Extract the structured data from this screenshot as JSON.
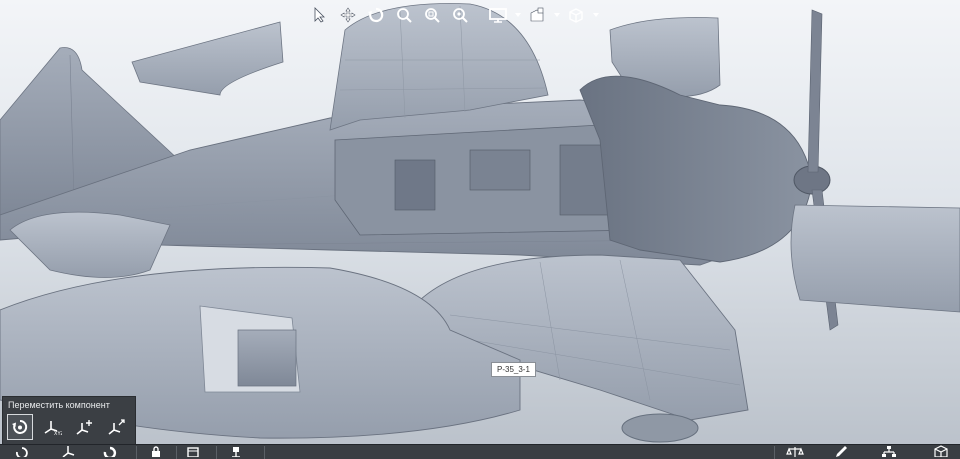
{
  "app": {
    "accent_color": "#2a6fd6",
    "toolbar_icon_color": "#ffffff"
  },
  "top_toolbar": {
    "buttons": [
      {
        "name": "select",
        "icon": "cursor-arrow-icon"
      },
      {
        "name": "pan",
        "icon": "move-arrows-icon"
      },
      {
        "name": "rotate",
        "icon": "orbit-rotate-icon"
      },
      {
        "name": "zoom",
        "icon": "zoom-icon"
      },
      {
        "name": "zoom-window",
        "icon": "zoom-window-icon"
      },
      {
        "name": "zoom-selected",
        "icon": "zoom-selected-icon"
      },
      {
        "name": "display-mode",
        "icon": "monitor-icon"
      },
      {
        "name": "appearance",
        "icon": "appearance-icon"
      },
      {
        "name": "view-orientation",
        "icon": "cube-view-icon"
      }
    ]
  },
  "viewport": {
    "part_tooltip": "P-35_3-1"
  },
  "move_panel": {
    "title": "Переместить компонент",
    "buttons": [
      {
        "name": "free-rotate",
        "icon": "rotate-component-icon",
        "active": true
      },
      {
        "name": "move-xyz",
        "icon": "triad-xyz-icon",
        "active": false
      },
      {
        "name": "move-along-entity",
        "icon": "triad-plus-icon",
        "active": false
      },
      {
        "name": "move-by-delta",
        "icon": "triad-arrows-icon",
        "active": false
      }
    ]
  },
  "bottom_toolbar": {
    "items": [
      {
        "icon": "rotate-component-icon"
      },
      {
        "icon": "triad-xyz-icon"
      },
      {
        "icon": "rotate-alt-icon"
      },
      {
        "icon": "lock-icon"
      },
      {
        "icon": "assembly-icon"
      },
      {
        "icon": "mate-icon"
      },
      {
        "icon": "balance-icon"
      },
      {
        "icon": "pencil-icon"
      },
      {
        "icon": "hierarchy-icon"
      },
      {
        "icon": "component-box-icon"
      }
    ]
  }
}
